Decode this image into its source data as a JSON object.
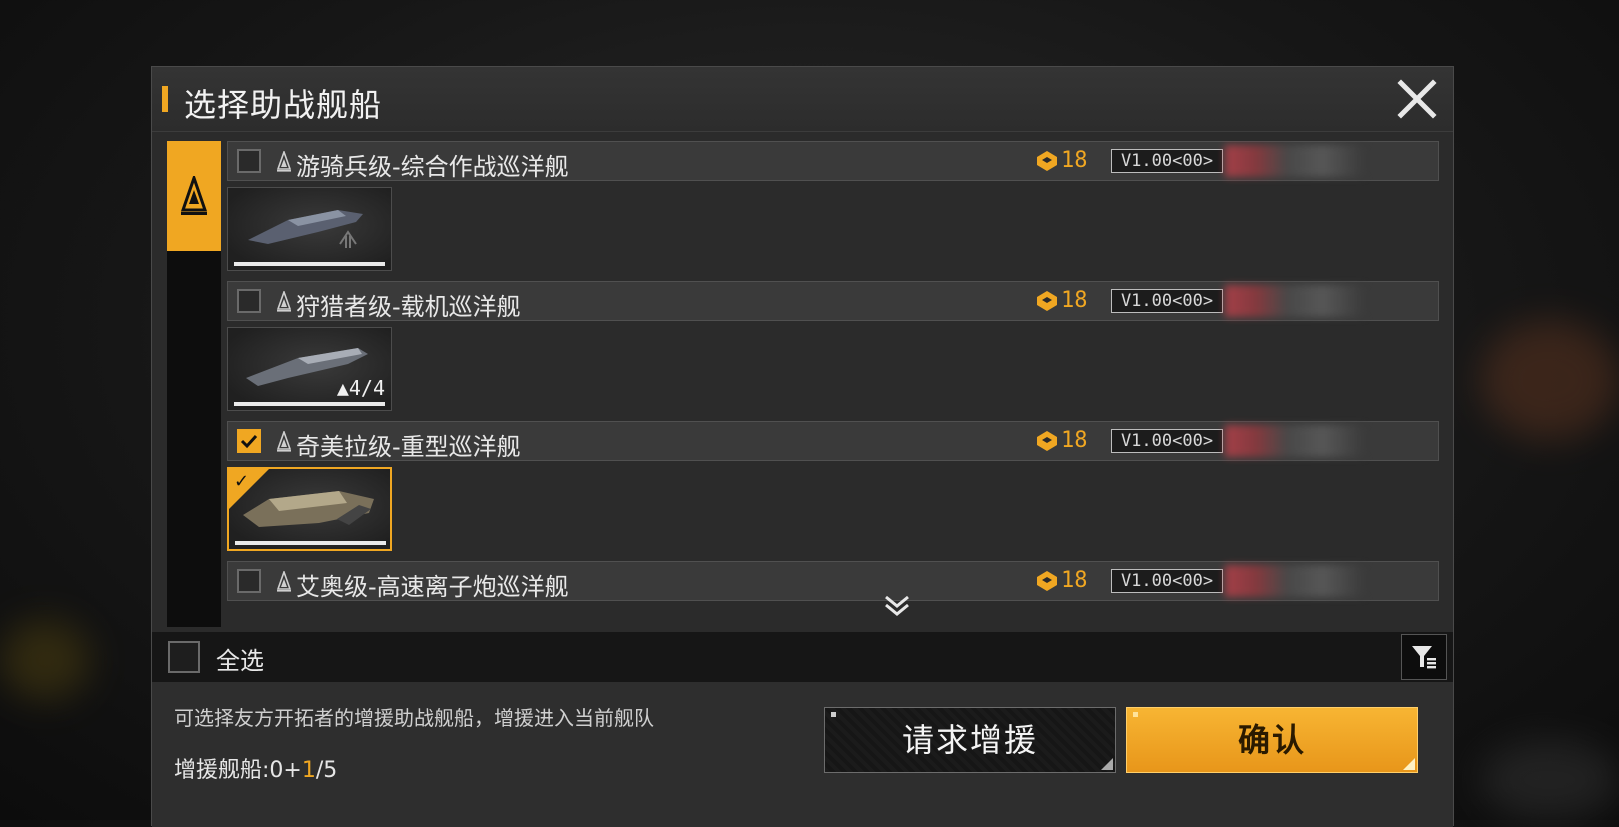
{
  "dialog": {
    "title": "选择助战舰船",
    "close_icon": "close-icon"
  },
  "category_tab": {
    "icon": "cruiser-class-icon"
  },
  "ships": [
    {
      "name": "游骑兵级-综合作战巡洋舰",
      "cost": "18",
      "version": "V1.00<00>",
      "checked": false,
      "selected": false,
      "count": ""
    },
    {
      "name": "狩猎者级-载机巡洋舰",
      "cost": "18",
      "version": "V1.00<00>",
      "checked": false,
      "selected": false,
      "count": "4/4"
    },
    {
      "name": "奇美拉级-重型巡洋舰",
      "cost": "18",
      "version": "V1.00<00>",
      "checked": true,
      "selected": true,
      "count": ""
    },
    {
      "name": "艾奥级-高速离子炮巡洋舰",
      "cost": "18",
      "version": "V1.00<00>",
      "checked": false,
      "selected": false,
      "count": ""
    }
  ],
  "select_all": {
    "label": "全选"
  },
  "footer": {
    "hint": "可选择友方开拓者的增援助战舰船，增援进入当前舰队",
    "count_label": "增援舰船:",
    "count_value": "0+",
    "count_highlight": "1",
    "count_total": "/5",
    "request_button": "请求增援",
    "confirm_button": "确认"
  },
  "colors": {
    "accent": "#f0a722",
    "panel": "#2b2b2b"
  }
}
